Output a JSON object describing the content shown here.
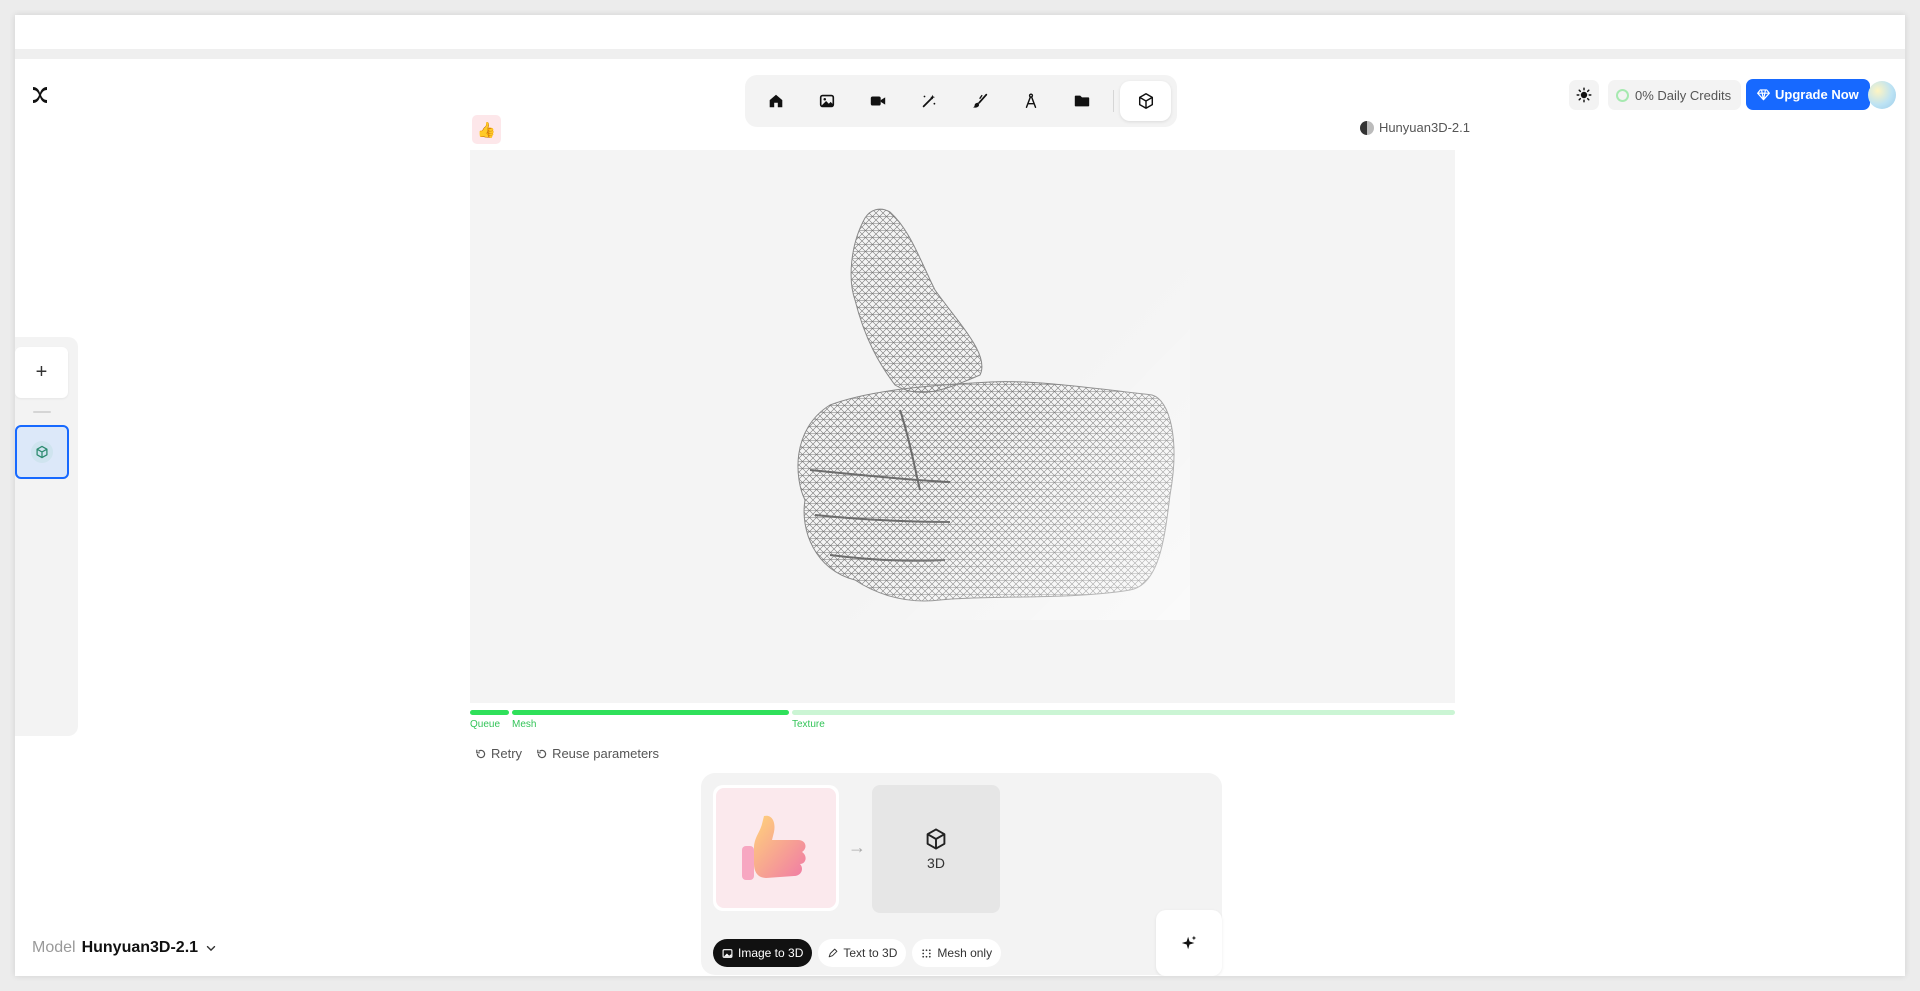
{
  "header": {
    "logo": "app-logo",
    "toolbar": [
      {
        "name": "home",
        "icon": "home-icon",
        "active": false
      },
      {
        "name": "image",
        "icon": "image-icon",
        "active": false
      },
      {
        "name": "video",
        "icon": "video-icon",
        "active": false
      },
      {
        "name": "edit",
        "icon": "magic-wand-icon",
        "active": false
      },
      {
        "name": "brush",
        "icon": "brush-icon",
        "active": false
      },
      {
        "name": "design",
        "icon": "compass-icon",
        "active": false
      },
      {
        "name": "assets",
        "icon": "folder-icon",
        "active": false
      },
      {
        "name": "3d",
        "icon": "cube-icon",
        "active": true
      }
    ],
    "credits_label": "0% Daily Credits",
    "upgrade_label": "Upgrade Now",
    "accent_color": "#1769ff"
  },
  "canvas": {
    "prompt_thumb": "👍",
    "model_tag": "Hunyuan3D-2.1",
    "progress": {
      "queue_label": "Queue",
      "mesh_label": "Mesh",
      "texture_label": "Texture",
      "queue_done": true,
      "mesh_done": true,
      "texture_progress": 0
    },
    "actions": {
      "retry": "Retry",
      "reuse": "Reuse parameters"
    }
  },
  "composer": {
    "input_emoji": "👍",
    "output_label": "3D",
    "modes": {
      "image_to_3d": "Image to 3D",
      "text_to_3d": "Text to 3D",
      "mesh_only": "Mesh only"
    }
  },
  "model_select": {
    "label": "Model",
    "value": "Hunyuan3D-2.1"
  }
}
